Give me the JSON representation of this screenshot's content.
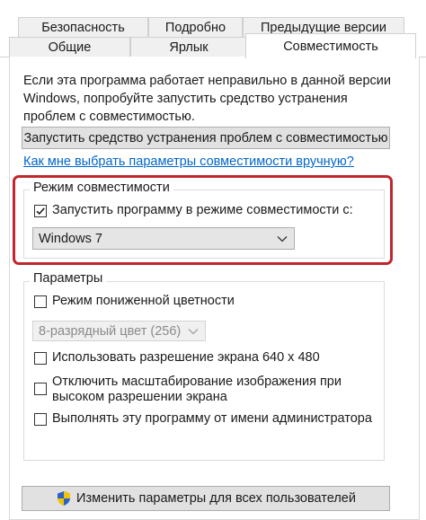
{
  "tabs": {
    "row1": [
      "Безопасность",
      "Подробно",
      "Предыдущие версии"
    ],
    "row2": [
      "Общие",
      "Ярлык",
      "Совместимость"
    ],
    "active": "Совместимость"
  },
  "intro_text": [
    "Если эта программа работает неправильно в данной версии",
    "Windows, попробуйте запустить средство устранения",
    "проблем с совместимостью."
  ],
  "troubleshooter_button": "Запустить средство устранения проблем с совместимостью",
  "manual_link": "Как мне выбрать параметры совместимости вручную?",
  "compat_mode": {
    "legend": "Режим совместимости",
    "checkbox_label": "Запустить программу в режиме совместимости с:",
    "checked": true,
    "selected_os": "Windows 7"
  },
  "settings": {
    "legend": "Параметры",
    "reduced_color": {
      "label": "Режим пониженной цветности",
      "checked": false
    },
    "color_select": "8-разрядный цвет (256)",
    "res_640": {
      "label": "Использовать разрешение экрана 640 x 480",
      "checked": false
    },
    "dpi_scaling": {
      "label_lines": [
        "Отключить масштабирование изображения при",
        "высоком разрешении экрана"
      ],
      "checked": false
    },
    "run_admin": {
      "label": "Выполнять эту программу от имени администратора",
      "checked": false
    }
  },
  "all_users_button": "Изменить параметры для всех пользователей",
  "colors": {
    "highlight": "#c0272d",
    "link": "#0066cc"
  }
}
